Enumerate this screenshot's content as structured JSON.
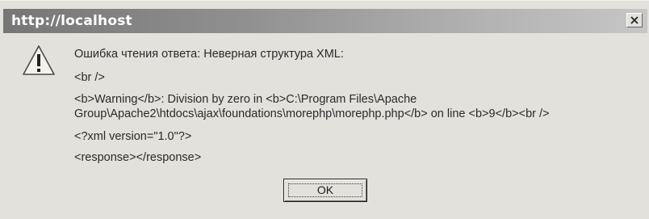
{
  "window": {
    "title": "http://localhost"
  },
  "message": {
    "lines": [
      "Ошибка чтения ответа: Неверная структура XML:",
      "<br />",
      "<b>Warning</b>: Division by zero in <b>C:\\Program Files\\Apache",
      "Group\\Apache2\\htdocs\\ajax\\foundations\\morephp\\morephp.php</b> on line <b>9</b><br />",
      "<?xml version=\"1.0\"?>",
      "<response></response>"
    ]
  },
  "buttons": {
    "ok_label": "OK"
  },
  "icons": {
    "warning": "warning-icon",
    "close": "close-icon"
  }
}
